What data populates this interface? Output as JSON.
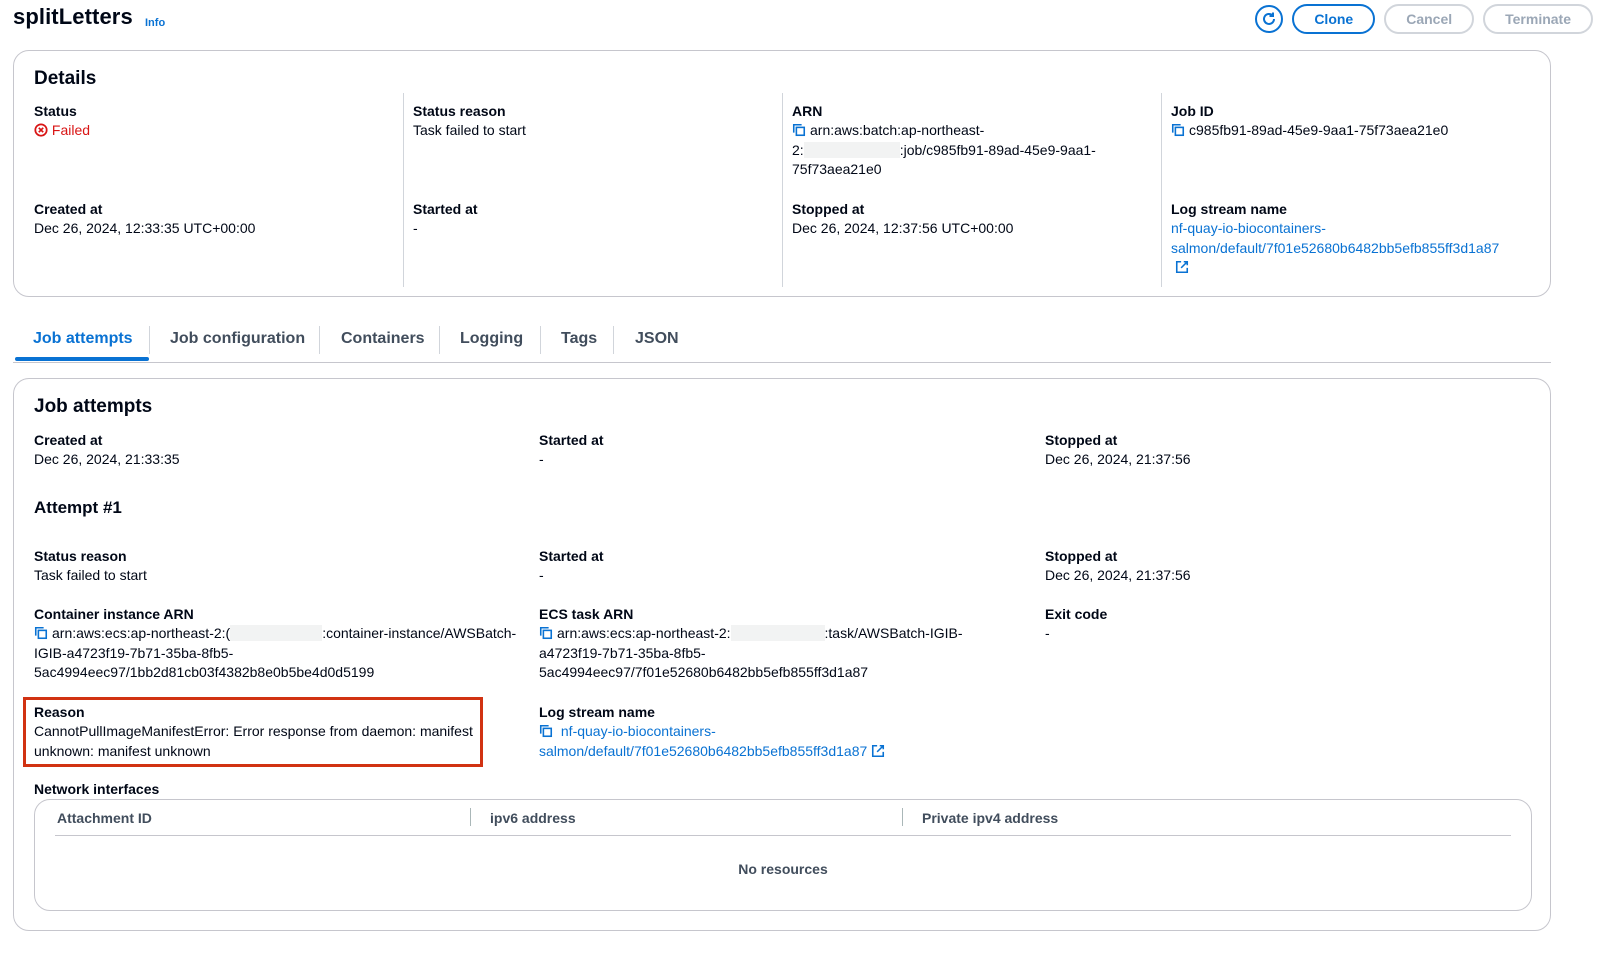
{
  "header": {
    "title": "splitLetters",
    "info": "Info",
    "buttons": {
      "clone": "Clone",
      "cancel": "Cancel",
      "terminate": "Terminate"
    }
  },
  "details": {
    "title": "Details",
    "status_label": "Status",
    "status_value": "Failed",
    "status_reason_label": "Status reason",
    "status_reason_value": "Task failed to start",
    "arn_label": "ARN",
    "arn_line1": "arn:aws:batch:ap-northeast-",
    "arn_line2_prefix": "2:",
    "arn_line2_suffix": ":job/c985fb91-89ad-45e9-9aa1-",
    "arn_line3": "75f73aea21e0",
    "job_id_label": "Job ID",
    "job_id_value": "c985fb91-89ad-45e9-9aa1-75f73aea21e0",
    "created_at_label": "Created at",
    "created_at_value": "Dec 26, 2024, 12:33:35 UTC+00:00",
    "started_at_label": "Started at",
    "started_at_value": "-",
    "stopped_at_label": "Stopped at",
    "stopped_at_value": "Dec 26, 2024, 12:37:56 UTC+00:00",
    "log_stream_label": "Log stream name",
    "log_stream_line1": "nf-quay-io-biocontainers-",
    "log_stream_line2": "salmon/default/7f01e52680b6482bb5efb855ff3d1a87"
  },
  "tabs": [
    "Job attempts",
    "Job configuration",
    "Containers",
    "Logging",
    "Tags",
    "JSON"
  ],
  "attempts": {
    "title": "Job attempts",
    "created_at_label": "Created at",
    "created_at_value": "Dec 26, 2024, 21:33:35",
    "started_at_label": "Started at",
    "started_at_value": "-",
    "stopped_at_label": "Stopped at",
    "stopped_at_value": "Dec 26, 2024, 21:37:56",
    "attempt_title": "Attempt #1",
    "status_reason_label": "Status reason",
    "status_reason_value": "Task failed to start",
    "a_started_at_label": "Started at",
    "a_started_at_value": "-",
    "a_stopped_at_label": "Stopped at",
    "a_stopped_at_value": "Dec 26, 2024, 21:37:56",
    "container_arn_label": "Container instance ARN",
    "container_arn_line1_prefix": "arn:aws:ecs:ap-northeast-2:(",
    "container_arn_line1_suffix": ":container-instance/AWSBatch-",
    "container_arn_line2": "IGIB-a4723f19-7b71-35ba-8fb5-",
    "container_arn_line3": "5ac4994eec97/1bb2d81cb03f4382b8e0b5be4d0d5199",
    "ecs_task_arn_label": "ECS task ARN",
    "ecs_task_arn_line1_prefix": "arn:aws:ecs:ap-northeast-2:",
    "ecs_task_arn_line1_suffix": ":task/AWSBatch-IGIB-",
    "ecs_task_arn_line2": "a4723f19-7b71-35ba-8fb5-",
    "ecs_task_arn_line3": "5ac4994eec97/7f01e52680b6482bb5efb855ff3d1a87",
    "exit_code_label": "Exit code",
    "exit_code_value": "-",
    "reason_label": "Reason",
    "reason_line1": "CannotPullImageManifestError: Error response from daemon: manifest",
    "reason_line2": "unknown: manifest unknown",
    "log_stream_label": "Log stream name",
    "log_stream_line1": "nf-quay-io-biocontainers-",
    "log_stream_line2": "salmon/default/7f01e52680b6482bb5efb855ff3d1a87",
    "network_label": "Network interfaces",
    "table_headers": [
      "Attachment ID",
      "ipv6 address",
      "Private ipv4 address"
    ],
    "table_empty": "No resources"
  },
  "colors": {
    "accent": "#0972d3",
    "error": "#d91515",
    "highlight_border": "#d13212"
  }
}
